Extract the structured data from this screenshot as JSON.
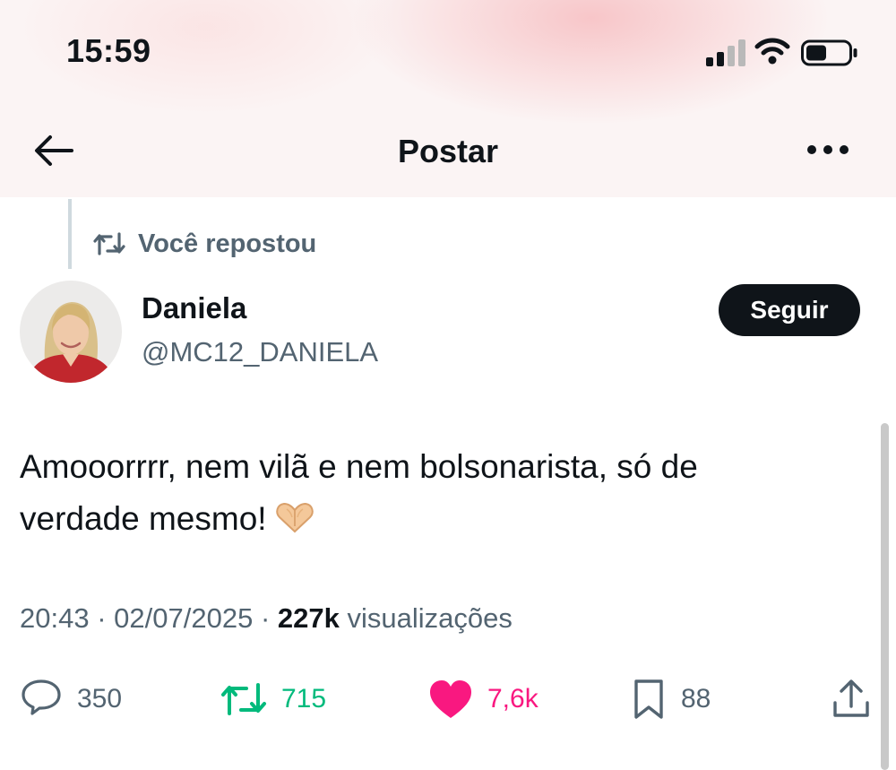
{
  "status_bar": {
    "time": "15:59",
    "signal_icon": "cellular-signal-icon",
    "wifi_icon": "wifi-icon",
    "battery_icon": "battery-icon"
  },
  "nav": {
    "title": "Postar",
    "back_icon": "back-arrow-icon",
    "more_icon": "more-options-icon"
  },
  "repost": {
    "label": "Você repostou",
    "icon": "retweet-icon"
  },
  "author": {
    "name": "Daniela",
    "handle": "@MC12_DANIELA",
    "follow_label": "Seguir"
  },
  "tweet": {
    "text_line1": "Amooorrrr, nem vilã e nem bolsonarista, só de",
    "text_line2": "verdade mesmo!",
    "emoji": "heart-hands-emoji"
  },
  "meta": {
    "time": "20:43",
    "separator": "·",
    "date": "02/07/2025",
    "views_count": "227k",
    "views_label": "visualizações"
  },
  "actions": {
    "replies": "350",
    "retweets": "715",
    "likes": "7,6k",
    "bookmarks": "88"
  },
  "colors": {
    "retweet_active": "#00ba7c",
    "like_active": "#f91880",
    "secondary_text": "#536471",
    "primary_text": "#0f1419"
  }
}
